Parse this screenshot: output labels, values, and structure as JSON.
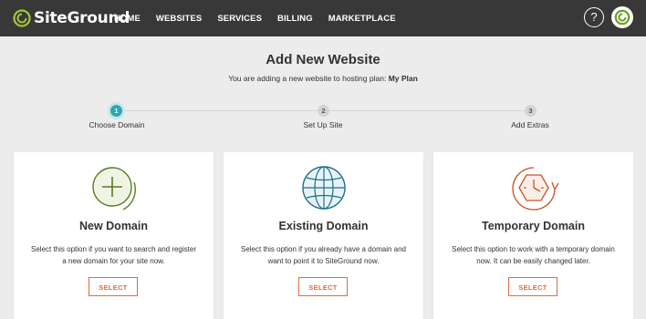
{
  "brand": {
    "name": "SiteGround"
  },
  "nav": {
    "items": [
      "HOME",
      "WEBSITES",
      "SERVICES",
      "BILLING",
      "MARKETPLACE"
    ]
  },
  "header_actions": {
    "help_label": "?"
  },
  "page": {
    "title": "Add New Website",
    "subtitle_prefix": "You are adding a new website to hosting plan:",
    "plan_name": "My Plan"
  },
  "steps": [
    {
      "number": "1",
      "label": "Choose Domain",
      "active": true
    },
    {
      "number": "2",
      "label": "Set Up Site",
      "active": false
    },
    {
      "number": "3",
      "label": "Add Extras",
      "active": false
    }
  ],
  "cards": [
    {
      "icon": "plus-circle-icon",
      "title": "New Domain",
      "desc_line1": "Select this option if you want to search and register",
      "desc_line2": "a new domain for your site now.",
      "button": "SELECT",
      "color": "#6a8a2a"
    },
    {
      "icon": "globe-icon",
      "title": "Existing Domain",
      "desc_line1": "Select this option if you already have a domain and",
      "desc_line2": "want to point it to SiteGround now.",
      "button": "SELECT",
      "color": "#1f6f8b"
    },
    {
      "icon": "clock-icon",
      "title": "Temporary Domain",
      "desc_line1": "Select this option to work with a temporary domain",
      "desc_line2": "now. It can be easily changed later.",
      "button": "SELECT",
      "color": "#c8532b"
    }
  ],
  "colors": {
    "topbar": "#383838",
    "accent": "#e26b36",
    "step_active": "#2ea8b3"
  }
}
